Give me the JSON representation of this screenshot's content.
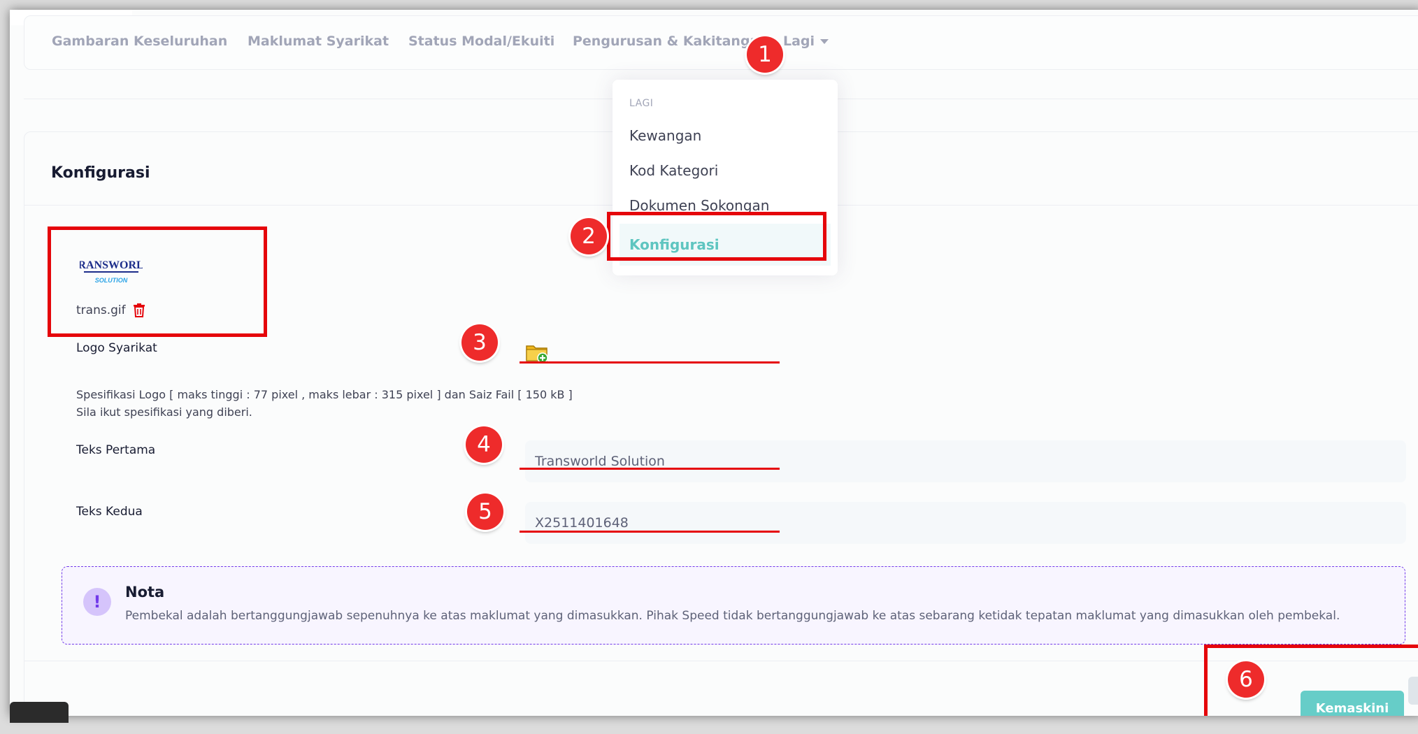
{
  "nav": {
    "items": [
      {
        "label": "Gambaran Keseluruhan"
      },
      {
        "label": "Maklumat Syarikat"
      },
      {
        "label": "Status Modal/Ekuiti"
      },
      {
        "label": "Pengurusan & Kakitangan"
      },
      {
        "label": "Lagi"
      }
    ]
  },
  "dropdown": {
    "header": "LAGI",
    "items": [
      {
        "label": "Kewangan"
      },
      {
        "label": "Kod Kategori"
      },
      {
        "label": "Dokumen Sokongan"
      },
      {
        "label": "Konfigurasi",
        "active": true
      }
    ]
  },
  "page": {
    "title": "Konfigurasi"
  },
  "logo": {
    "image_text_top": "TRANSWORLD",
    "image_text_bottom": "SOLUTION",
    "filename": "trans.gif",
    "label": "Logo Syarikat"
  },
  "spec": {
    "line1": "Spesifikasi Logo [ maks tinggi : 77 pixel , maks lebar : 315 pixel ] dan Saiz Fail [ 150 kB ]",
    "line2": "Sila ikut spesifikasi yang diberi."
  },
  "fields": {
    "teks_pertama": {
      "label": "Teks Pertama",
      "value": "Transworld Solution"
    },
    "teks_kedua": {
      "label": "Teks Kedua",
      "value": "X2511401648"
    }
  },
  "nota": {
    "title": "Nota",
    "text": "Pembekal adalah bertanggungjawab sepenuhnya ke atas maklumat yang dimasukkan. Pihak Speed tidak bertanggungjawab ke atas sebarang ketidak tepatan maklumat yang dimasukkan oleh pembekal."
  },
  "actions": {
    "submit_label": "Kemaskini"
  },
  "annotations": {
    "badges": [
      "1",
      "2",
      "3",
      "4",
      "5",
      "6"
    ]
  },
  "colors": {
    "accent": "#66cdc8",
    "annotation_red": "#e5050b",
    "nota_border": "#7239ea"
  }
}
